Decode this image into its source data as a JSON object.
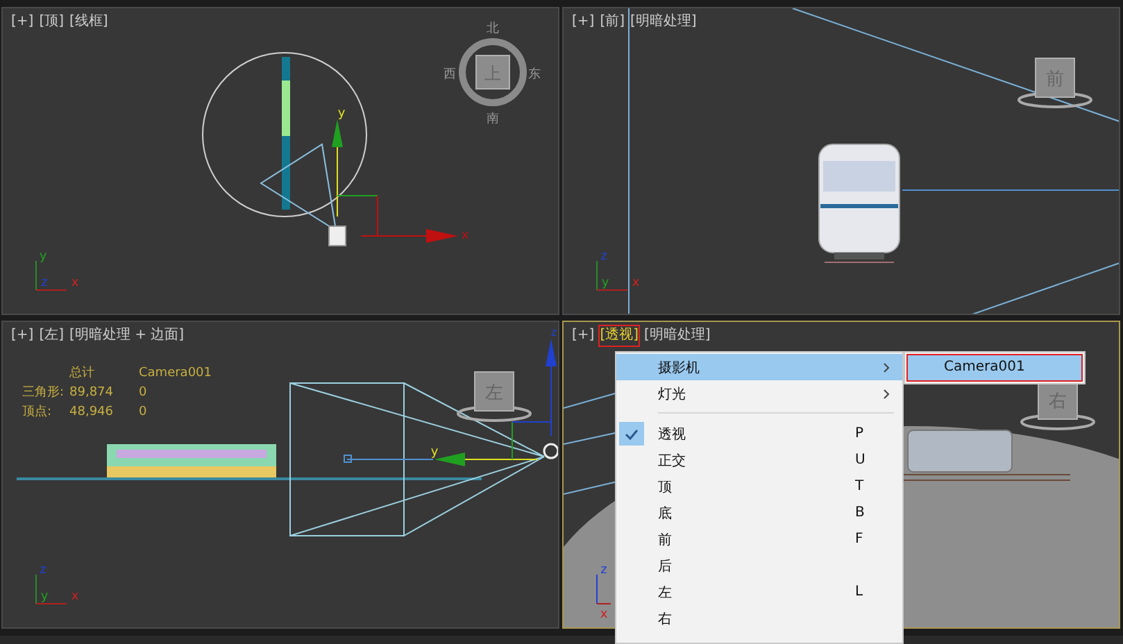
{
  "viewports": [
    {
      "kind": "top",
      "active": false,
      "plus": "[+]",
      "view": "[顶]",
      "shading": "[线框]",
      "annotated": false,
      "viewcube": {
        "face": "上",
        "compass": [
          "北",
          "东",
          "南",
          "西"
        ]
      },
      "tripod": [
        "y",
        "z",
        "x"
      ],
      "gizmo": [
        "y",
        "x"
      ]
    },
    {
      "kind": "front",
      "active": false,
      "plus": "[+]",
      "view": "[前]",
      "shading": "[明暗处理]",
      "annotated": false,
      "viewcube": {
        "face": "前"
      },
      "tripod": [
        "z",
        "y",
        "x"
      ]
    },
    {
      "kind": "left",
      "active": false,
      "plus": "[+]",
      "view": "[左]",
      "shading": "[明暗处理 + 边面]",
      "annotated": false,
      "viewcube": {
        "face": "左"
      },
      "tripod": [
        "z",
        "y",
        "x"
      ],
      "gizmo": [
        "z",
        "y"
      ],
      "stats": {
        "columns": [
          "总计",
          "Camera001"
        ],
        "rows": [
          {
            "label": "三角形:",
            "total": "89,874",
            "selected": "0"
          },
          {
            "label": "顶点:",
            "total": "48,946",
            "selected": "0"
          }
        ]
      }
    },
    {
      "kind": "perspective",
      "active": true,
      "plus": "[+]",
      "view": "[透视]",
      "shading": "[明暗处理]",
      "annotated": true,
      "viewcube": {
        "face": "右"
      },
      "tripod": [
        "z",
        "x"
      ]
    }
  ],
  "menu": {
    "items": [
      {
        "kind": "item",
        "label": "摄影机",
        "submenu": true,
        "checked": false,
        "selected": true
      },
      {
        "kind": "item",
        "label": "灯光",
        "submenu": true,
        "checked": false,
        "selected": false
      },
      {
        "kind": "separator"
      },
      {
        "kind": "item",
        "label": "透视",
        "shortcut": "P",
        "submenu": false,
        "checked": true,
        "selected": false
      },
      {
        "kind": "item",
        "label": "正交",
        "shortcut": "U",
        "submenu": false,
        "checked": false,
        "selected": false
      },
      {
        "kind": "item",
        "label": "顶",
        "shortcut": "T",
        "submenu": false,
        "checked": false,
        "selected": false
      },
      {
        "kind": "item",
        "label": "底",
        "shortcut": "B",
        "submenu": false,
        "checked": false,
        "selected": false
      },
      {
        "kind": "item",
        "label": "前",
        "shortcut": "F",
        "submenu": false,
        "checked": false,
        "selected": false
      },
      {
        "kind": "item",
        "label": "后",
        "submenu": false,
        "checked": false,
        "selected": false
      },
      {
        "kind": "item",
        "label": "左",
        "shortcut": "L",
        "submenu": false,
        "checked": false,
        "selected": false
      },
      {
        "kind": "item",
        "label": "右",
        "submenu": false,
        "checked": false,
        "selected": false
      }
    ]
  },
  "submenu": {
    "items": [
      {
        "label": "Camera001",
        "selected": true,
        "annotated": true
      }
    ]
  }
}
